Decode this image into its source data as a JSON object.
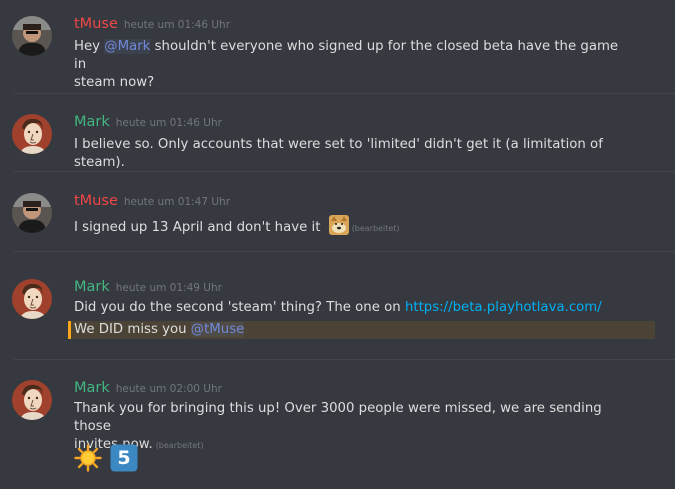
{
  "messages": [
    {
      "author": "tMuse",
      "time": "heute um 01:46 Uhr",
      "line1_pre": "Hey ",
      "mention": "@Mark",
      "line1_post": " shouldn't everyone who signed up for the closed beta have the game in",
      "line2": "steam now?"
    },
    {
      "author": "Mark",
      "time": "heute um 01:46 Uhr",
      "text": "I believe so.  Only accounts that were set to 'limited' didn't get it (a limitation of steam)."
    },
    {
      "author": "tMuse",
      "time": "heute um 01:47 Uhr",
      "text": "I signed up 13 April and don't have it ",
      "emoji": "doge-emoji",
      "edited": "(bearbeitet)"
    },
    {
      "author": "Mark",
      "time": "heute um 01:49 Uhr",
      "text_pre": "Did you do the second 'steam' thing?  The one on ",
      "link": "https://beta.playhotlava.com/",
      "highlight_pre": "We DID miss you ",
      "highlight_mention": "@tMuse"
    },
    {
      "author": "Mark",
      "time": "heute um 02:00 Uhr",
      "line1": "Thank you for bringing this up! Over 3000 people were missed, we are sending those",
      "line2": "invites now.",
      "edited": "(bearbeitet)",
      "reactions": [
        "sun-emoji",
        "five-emoji"
      ],
      "five_label": "5"
    }
  ],
  "colors": {
    "background": "#36393f",
    "tmuse": "#f04747",
    "mark": "#43b581",
    "mention": "#7289da",
    "link": "#00b0f4",
    "highlight_border": "#faa61a"
  }
}
